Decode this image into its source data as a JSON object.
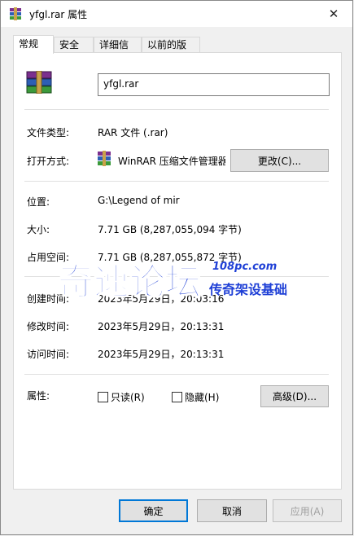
{
  "window": {
    "title": "yfgl.rar 属性",
    "close": "✕"
  },
  "tabs": [
    {
      "label": "常规"
    },
    {
      "label": "安全"
    },
    {
      "label": "详细信息"
    },
    {
      "label": "以前的版本"
    }
  ],
  "general": {
    "filename": "yfgl.rar",
    "file_type_label": "文件类型:",
    "file_type_value": "RAR 文件 (.rar)",
    "opens_with_label": "打开方式:",
    "opens_with_value": "WinRAR 压缩文件管理器",
    "change_button": "更改(C)...",
    "location_label": "位置:",
    "location_value": "G:\\Legend of mir",
    "size_label": "大小:",
    "size_value": "7.71 GB (8,287,055,094 字节)",
    "size_on_disk_label": "占用空间:",
    "size_on_disk_value": "7.71 GB (8,287,055,872 字节)",
    "created_label": "创建时间:",
    "created_value": "2023年5月29日，20:03:16",
    "modified_label": "修改时间:",
    "modified_value": "2023年5月29日，20:13:31",
    "accessed_label": "访问时间:",
    "accessed_value": "2023年5月29日，20:13:31",
    "attributes_label": "属性:",
    "readonly_label": "只读(R)",
    "hidden_label": "隐藏(H)",
    "advanced_button": "高级(D)..."
  },
  "footer": {
    "ok": "确定",
    "cancel": "取消",
    "apply": "应用(A)"
  },
  "watermark": {
    "main": "奇速论坛",
    "url": "108pc.com",
    "sub": "传奇架设基础"
  },
  "colors": {
    "accent": "#0078d7",
    "watermark_blue": "#1e3fd6"
  }
}
